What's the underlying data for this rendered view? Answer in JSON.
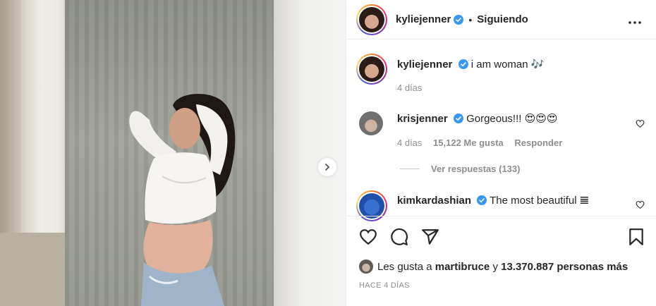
{
  "post": {
    "author": "kyliejenner",
    "follow_status": "Siguiendo",
    "caption": "i am woman 🎶",
    "caption_age": "4 días"
  },
  "comments": [
    {
      "username": "krisjenner",
      "text": "Gorgeous!!! 😍😍😍",
      "age": "4 días",
      "likes": "15,122 Me gusta",
      "reply_label": "Responder",
      "view_replies": "Ver respuestas (133)"
    },
    {
      "username": "kimkardashian",
      "text": "The most beautiful 𝌆"
    }
  ],
  "likes": {
    "prefix": "Les gusta a",
    "liker": "martibruce",
    "connector": "y",
    "count_text": "13.370.887 personas más"
  },
  "timestamp": "HACE 4 DÍAS",
  "icons": {
    "verified": "verified-badge-icon",
    "more": "more-options-icon",
    "like": "heart-icon",
    "comment": "comment-icon",
    "share": "share-icon",
    "save": "bookmark-icon",
    "next": "chevron-right-icon"
  },
  "colors": {
    "verified": "#3897f0",
    "text": "#262626",
    "muted": "#8e8e8e"
  }
}
